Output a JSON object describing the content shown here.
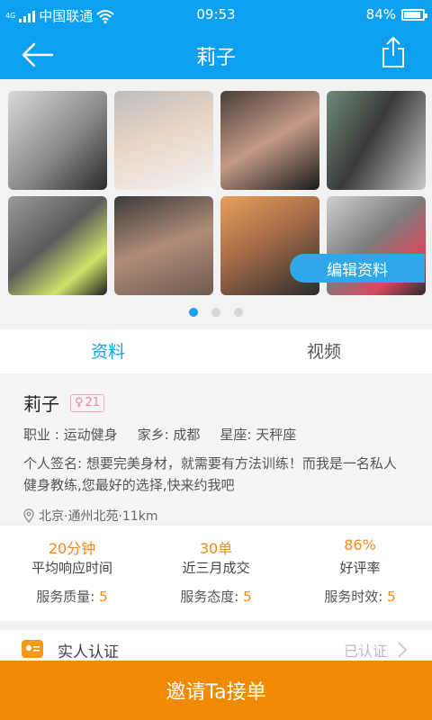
{
  "status_bar": {
    "network_tag": "4G",
    "carrier": "中国联通",
    "time": "09:53",
    "battery": "84%",
    "battery_level": 0.84
  },
  "nav": {
    "title": "莉子",
    "back_icon": "arrow-left-icon",
    "share_icon": "share-icon"
  },
  "gallery": {
    "edit_button": "编辑资料",
    "page_count": 3,
    "active_page": 0
  },
  "tabs": [
    {
      "label": "资料",
      "active": true
    },
    {
      "label": "视频",
      "active": false
    }
  ],
  "profile": {
    "name": "莉子",
    "gender_symbol": "♀",
    "age": "21",
    "occupation": "职业 : 运动健身",
    "hometown": "家乡: 成都",
    "zodiac": "星座: 天秤座",
    "bio": "个人签名: 想要完美身材，就需要有方法训练！而我是一名私人健身教练,您最好的选择,快来约我吧",
    "location": "北京·通州北苑·11km"
  },
  "stats": [
    {
      "value": "20分钟",
      "label": "平均响应时间",
      "rating_label": "服务质量:",
      "rating": "5"
    },
    {
      "value": "30单",
      "label": "近三月成交",
      "rating_label": "服务态度:",
      "rating": "5"
    },
    {
      "value": "86%",
      "label": "好评率",
      "rating_label": "服务时效:",
      "rating": "5"
    }
  ],
  "verify": {
    "label": "实人认证",
    "status": "已认证"
  },
  "cta": {
    "label": "邀请Ta接单"
  },
  "colors": {
    "primary_blue": "#0ea0f0",
    "accent_orange": "#f08a00",
    "stat_orange": "#f08a1c",
    "gender_pink": "#f37fae"
  }
}
